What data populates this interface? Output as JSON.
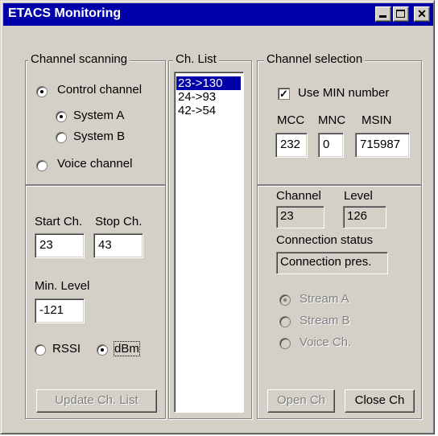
{
  "window": {
    "title": "ETACS Monitoring"
  },
  "title_buttons": {
    "minimize": "",
    "maximize": "",
    "close": "✕"
  },
  "channel_scanning": {
    "legend": "Channel scanning",
    "control_channel": "Control channel",
    "system_a": "System A",
    "system_b": "System B",
    "voice_channel": "Voice channel",
    "start_label": "Start Ch.",
    "stop_label": "Stop Ch.",
    "start_value": "23",
    "stop_value": "43",
    "min_level_label": "Min. Level",
    "min_level_value": "-121",
    "rssi_label": "RSSI",
    "dbm_label": "dBm",
    "update_button": "Update Ch. List"
  },
  "ch_list": {
    "legend": "Ch. List",
    "items": [
      "23->130",
      "24->93",
      "42->54"
    ],
    "selected_index": 0
  },
  "channel_selection": {
    "legend": "Channel selection",
    "use_min_label": "Use MIN number",
    "use_min_checked": true,
    "mcc_label": "MCC",
    "mnc_label": "MNC",
    "msin_label": "MSIN",
    "mcc_value": "232",
    "mnc_value": "0",
    "msin_value": "715987",
    "channel_label": "Channel",
    "level_label": "Level",
    "channel_value": "23",
    "level_value": "126",
    "status_label": "Connection status",
    "status_value": "Connection pres.",
    "stream_a": "Stream A",
    "stream_b": "Stream B",
    "voice_ch": "Voice Ch.",
    "open_button": "Open Ch",
    "close_button": "Close Ch"
  }
}
